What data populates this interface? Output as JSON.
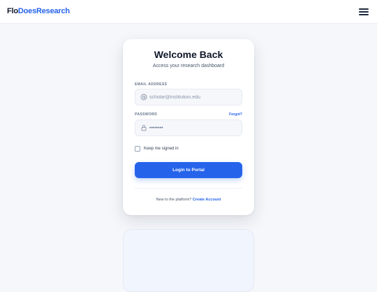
{
  "header": {
    "brand_prefix": "Flo",
    "brand_suffix": "DoesResearch"
  },
  "login": {
    "title": "Welcome Back",
    "subtitle": "Access your research dashboard",
    "email_label": "EMAIL ADDRESS",
    "email_placeholder": "scholar@institution.edu",
    "email_value": "",
    "password_label": "PASSWORD",
    "forgot_label": "Forgot?",
    "password_value": "••••••••",
    "remember_label": "Keep me signed in",
    "remember_checked": false,
    "submit_label": "Login to Portal",
    "footer_prompt": "New to the platform?",
    "footer_link": "Create Account"
  },
  "colors": {
    "accent": "#2563eb",
    "background": "#f5f7fb",
    "text": "#0f172a"
  },
  "icons": {
    "menu": "hamburger-icon",
    "email": "at-sign-icon",
    "password": "lock-icon"
  }
}
